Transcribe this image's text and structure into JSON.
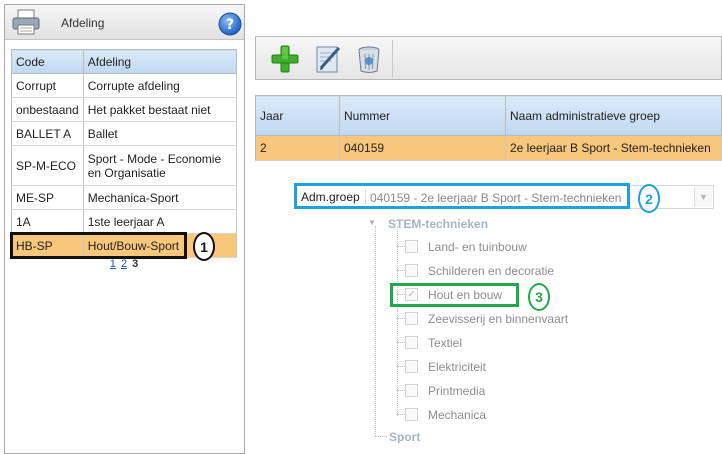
{
  "left_panel": {
    "title": "Afdeling",
    "icons": {
      "print": "printer-icon",
      "help": "help-icon"
    },
    "table": {
      "headers": {
        "code": "Code",
        "afdeling": "Afdeling"
      },
      "rows": [
        {
          "code": "Corrupt",
          "afdeling": "Corrupte afdeling"
        },
        {
          "code": "onbestaand",
          "afdeling": "Het pakket bestaat niet"
        },
        {
          "code": "BALLET A",
          "afdeling": "Ballet"
        },
        {
          "code": "SP-M-ECO",
          "afdeling": "Sport - Mode - Economie en Organisatie"
        },
        {
          "code": "ME-SP",
          "afdeling": "Mechanica-Sport"
        },
        {
          "code": "1A",
          "afdeling": "1ste leerjaar A"
        },
        {
          "code": "HB-SP",
          "afdeling": "Hout/Bouw-Sport"
        }
      ]
    },
    "pager": {
      "page1": "1",
      "page2": "2",
      "current": "3"
    }
  },
  "toolbar": {
    "add_icon": "add-icon",
    "edit_icon": "edit-icon",
    "delete_icon": "delete-icon"
  },
  "group_table": {
    "headers": {
      "jaar": "Jaar",
      "nummer": "Nummer",
      "naam": "Naam administratieve groep"
    },
    "row": {
      "jaar": "2",
      "nummer": "040159",
      "naam": "2e leerjaar B Sport - Stem-technieken"
    }
  },
  "adm_group": {
    "label": "Adm.groep",
    "value": "040159 - 2e leerjaar B Sport - Stem-technieken"
  },
  "tree": {
    "root": "STEM-technieken",
    "children": [
      "Land- en tuinbouw",
      "Schilderen en decoratie",
      "Hout en bouw",
      "Zeevisserij en binnenvaart",
      "Textiel",
      "Elektriciteit",
      "Printmedia",
      "Mechanica"
    ],
    "checked": "Hout en bouw",
    "second_root": "Sport"
  },
  "callouts": {
    "one": "1",
    "two": "2",
    "three": "3"
  },
  "colors": {
    "selected_row": "#f8c77b",
    "header_blue": "#c9dff5",
    "callout_one": "#111111",
    "callout_two": "#1ea1e0",
    "callout_three": "#20a84a"
  }
}
